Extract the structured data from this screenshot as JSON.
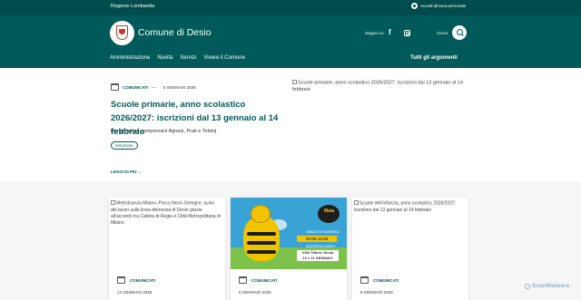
{
  "slimbar": {
    "region": "Regione Lombardia",
    "login": "Accedi all'area personale"
  },
  "header": {
    "title": "Comune di Desio",
    "social_label": "Seguici su",
    "search_label": "Cerca"
  },
  "nav": {
    "items": [
      "Amministrazione",
      "Novità",
      "Servizi",
      "Vivere il Comune"
    ],
    "all_topics": "Tutti gli argomenti"
  },
  "hero": {
    "category": "COMUNICATI",
    "separator": "—",
    "date": "5 GENNAIO 2026",
    "title": "Scuole primarie, anno scolastico 2026/2027: iscrizioni dal 13 gennaio al 14 febbraio",
    "subtitle": "Per gli Istituti comprensivi Agnesi, Prati e Tolstoj",
    "tag": "Istruzione",
    "read_more": "LEGGI DI PIÙ",
    "image_alt": "Scuole primarie, anno scolastico 2026/2027: iscrizioni dal 13 gennaio al 14 febbraio"
  },
  "cards": [
    {
      "image_alt": "Metrotranvia Milano–Parco Nord–Seregno: avvio dei lavori sulla linea dismessa di Desio grazie all'accordo tra Cabina di Regia e Città Metropolitana di Milano",
      "category": "COMUNICATI",
      "date": "12 GENNAIO 2026"
    },
    {
      "image_alt": "",
      "category": "COMUNICATI",
      "date": "8 GENNAIO 2026",
      "poster": {
        "badge": "Maia",
        "line1": "SABATO E DOMENICA",
        "time": "10:00-12:00",
        "line2": "INGRESSO LIBERO",
        "venue": "Villa Tittoni, Desio",
        "venue_sub": "10 e 11 GENNAIO"
      }
    },
    {
      "image_alt": "Scuole dell'infanzia, anno scolastico 2026/2027: iscrizioni dal 13 gennaio al 14 febbraio",
      "category": "COMUNICATI",
      "date": "8 GENNAIO 2026"
    }
  ],
  "watermark": "ScanMalware",
  "colors": {
    "primary": "#005a5a",
    "slimbar": "#004c4c",
    "background": "#ffffff",
    "cards_bg": "#f6f6f6"
  }
}
